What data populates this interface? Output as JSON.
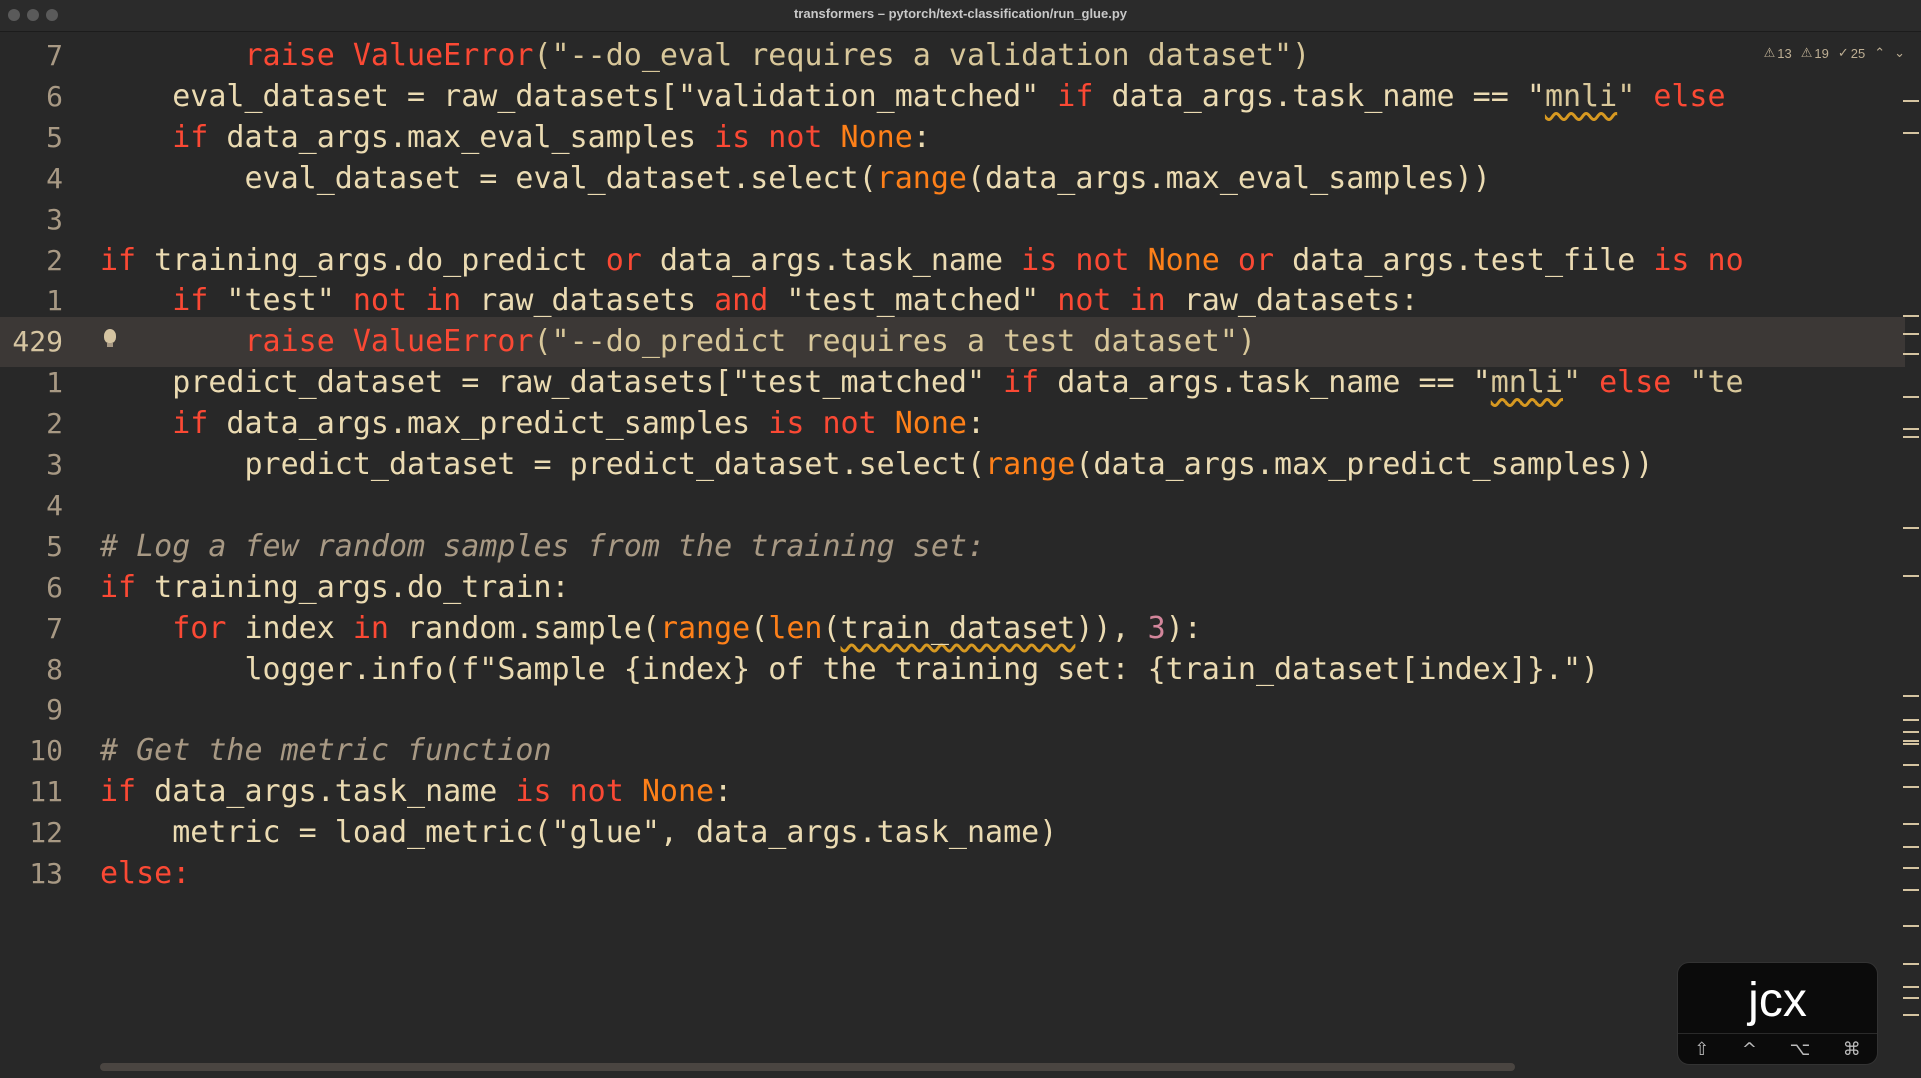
{
  "window": {
    "title": "transformers – pytorch/text-classification/run_glue.py"
  },
  "inspection": {
    "warnings_a": "13",
    "warnings_b": "19",
    "typos": "25"
  },
  "gutter": {
    "current_line": "429"
  },
  "lines": [
    {
      "num": "7",
      "current": false
    },
    {
      "num": "6",
      "current": false
    },
    {
      "num": "5",
      "current": false
    },
    {
      "num": "4",
      "current": false
    },
    {
      "num": "3",
      "current": false
    },
    {
      "num": "2",
      "current": false
    },
    {
      "num": "1",
      "current": false
    },
    {
      "num": "429",
      "current": true
    },
    {
      "num": "1",
      "current": false
    },
    {
      "num": "2",
      "current": false
    },
    {
      "num": "3",
      "current": false
    },
    {
      "num": "4",
      "current": false
    },
    {
      "num": "5",
      "current": false
    },
    {
      "num": "6",
      "current": false
    },
    {
      "num": "7",
      "current": false
    },
    {
      "num": "8",
      "current": false
    },
    {
      "num": "9",
      "current": false
    },
    {
      "num": "10",
      "current": false
    },
    {
      "num": "11",
      "current": false
    },
    {
      "num": "12",
      "current": false
    },
    {
      "num": "13",
      "current": false
    }
  ],
  "code": {
    "l1": [
      "        ",
      "raise",
      " ",
      "ValueError",
      "(\"--do_eval requires a validation dataset\")"
    ],
    "l2": [
      "    eval_dataset = raw_datasets[\"validation_matched\" ",
      "if",
      " data_args.task_name == \"",
      "mnli",
      "\" ",
      "else"
    ],
    "l3": [
      "    ",
      "if",
      " data_args.max_eval_samples ",
      "is",
      " ",
      "not",
      " ",
      "None",
      ":"
    ],
    "l4": [
      "        eval_dataset = eval_dataset.select(",
      "range",
      "(data_args.max_eval_samples))"
    ],
    "l5": [
      ""
    ],
    "l6": [
      "",
      "if",
      " training_args.do_predict ",
      "or",
      " data_args.task_name ",
      "is",
      " ",
      "not",
      " ",
      "None",
      " ",
      "or",
      " data_args.test_file ",
      "is",
      " ",
      "no"
    ],
    "l7": [
      "    ",
      "if",
      " \"test\" ",
      "not",
      " ",
      "in",
      " raw_datasets ",
      "and",
      " \"test_matched\" ",
      "not",
      " ",
      "in",
      " raw_datasets:"
    ],
    "l8": [
      "        ",
      "raise",
      " ",
      "ValueError",
      "(\"--do_predict requires a test dataset\")"
    ],
    "l9": [
      "    predict_dataset = raw_datasets[\"test_matched\" ",
      "if",
      " data_args.task_name == \"",
      "mnli",
      "\" ",
      "else",
      " \"te"
    ],
    "l10": [
      "    ",
      "if",
      " data_args.max_predict_samples ",
      "is",
      " ",
      "not",
      " ",
      "None",
      ":"
    ],
    "l11": [
      "        predict_dataset = predict_dataset.select(",
      "range",
      "(data_args.max_predict_samples))"
    ],
    "l12": [
      ""
    ],
    "l13": [
      "# Log a few random samples from the training set:"
    ],
    "l14": [
      "",
      "if",
      " training_args.do_train:"
    ],
    "l15": [
      "    ",
      "for",
      " index ",
      "in",
      " random.sample(",
      "range",
      "(",
      "len",
      "(",
      "train_dataset",
      ")), ",
      "3",
      "):"
    ],
    "l16": [
      "        logger.info(f\"Sample {index} of the training set: {train_dataset[index]}.\")"
    ],
    "l17": [
      ""
    ],
    "l18": [
      "# Get the metric function"
    ],
    "l19": [
      "",
      "if",
      " data_args.task_name ",
      "is",
      " ",
      "not",
      " ",
      "None",
      ":"
    ],
    "l20": [
      "    metric = load_metric(\"glue\", data_args.task_name)"
    ],
    "l21": [
      "else:"
    ]
  },
  "keycast": {
    "text": "jcx",
    "mods": [
      "⇧",
      "^",
      "⌥",
      "⌘"
    ]
  },
  "colors": {
    "background": "#282828",
    "keyword": "#fb4934",
    "builtin": "#fe8019",
    "string": "#d8c79a",
    "comment": "#a89984",
    "current_line": "#3c3836"
  }
}
